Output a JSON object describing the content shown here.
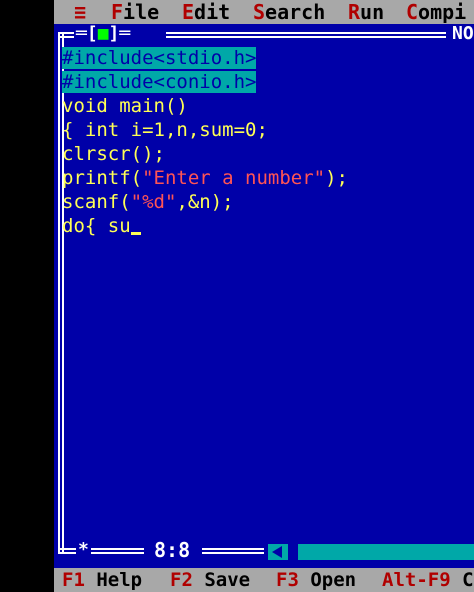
{
  "menu": {
    "system_glyph": "≡",
    "items": [
      {
        "hot": "F",
        "rest": "ile"
      },
      {
        "hot": "E",
        "rest": "dit"
      },
      {
        "hot": "S",
        "rest": "earch"
      },
      {
        "hot": "R",
        "rest": "un"
      },
      {
        "hot": "C",
        "rest": "ompi"
      }
    ]
  },
  "window": {
    "close_box_left": "═[",
    "close_box_mark": "■",
    "close_box_right": "]═",
    "title": "NO"
  },
  "code": {
    "line1": "#include<stdio.h>",
    "line2": "#include<conio.h>",
    "line3": "void main()",
    "line4_a": "{ int i=1,n,sum=",
    "line4_num": "0",
    "line4_b": ";",
    "line5": "clrscr();",
    "line6_a": "printf(",
    "line6_str": "\"Enter a number\"",
    "line6_b": ");",
    "line7_a": "scanf(",
    "line7_str": "\"%d\"",
    "line7_b": ",&n);",
    "line8": "do{ su"
  },
  "status": {
    "star": "*",
    "cursor_position": "8:8"
  },
  "help": {
    "items": [
      {
        "key": "F1",
        "label": "Help"
      },
      {
        "key": "F2",
        "label": "Save"
      },
      {
        "key": "F3",
        "label": "Open"
      },
      {
        "key": "Alt-F9",
        "label": "C"
      }
    ]
  },
  "colors": {
    "editor_bg": "#0000a8",
    "menu_bg": "#a8a8a8",
    "code_text": "#ffff54",
    "string_literal": "#ff5454",
    "selection_bg": "#00a8a8",
    "hotkey": "#b00000"
  }
}
